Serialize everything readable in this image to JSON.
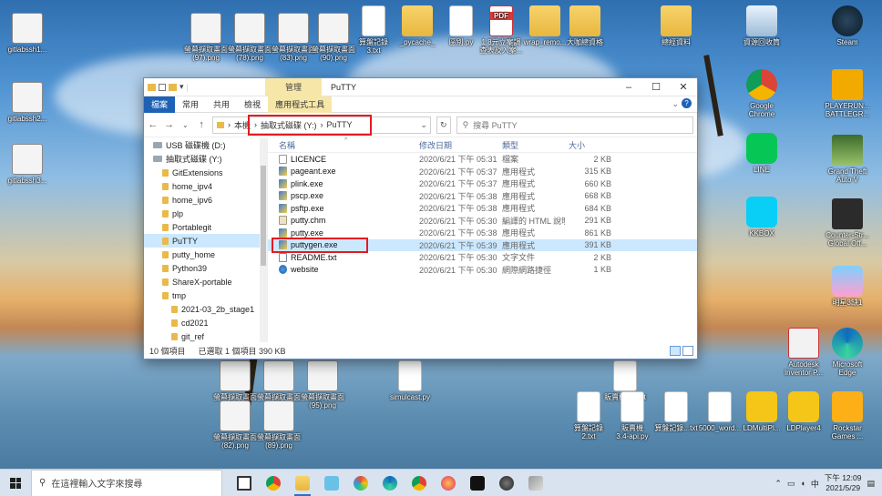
{
  "desktop": {
    "icons_left": [
      {
        "label": "gitlabssh1...",
        "icon": "thumbnail-icon"
      },
      {
        "label": "gitlabssh2...",
        "icon": "thumbnail-icon"
      },
      {
        "label": "gitlabssh3...",
        "icon": "thumbnail-icon"
      }
    ],
    "icons_top": [
      {
        "label": "螢幕擷取畫面\n(97).png",
        "icon": "thumbnail-icon"
      },
      {
        "label": "螢幕擷取畫面\n(78).png",
        "icon": "thumbnail-icon"
      },
      {
        "label": "螢幕擷取畫面\n(83).png",
        "icon": "thumbnail-icon"
      },
      {
        "label": "螢幕擷取畫面\n(90).png",
        "icon": "thumbnail-icon"
      },
      {
        "label": "算盤記錄\n3.txt",
        "icon": "document-icon"
      },
      {
        "label": "_pycache_",
        "icon": "folder-icon"
      },
      {
        "label": "區別.py",
        "icon": "document-icon"
      },
      {
        "label": "1.8元立案調\n查表及入案...",
        "icon": "pdf-icon"
      },
      {
        "label": "wrap_remo...",
        "icon": "folder-icon"
      },
      {
        "label": "大咖總資格",
        "icon": "folder-icon"
      },
      {
        "label": "總經資料",
        "icon": "folder-icon"
      },
      {
        "label": "資源回收筒",
        "icon": "recycle-bin-icon"
      },
      {
        "label": "Steam",
        "icon": "steam-icon"
      }
    ],
    "icons_right": [
      {
        "label": "Google\nChrome",
        "icon": "chrome-icon"
      },
      {
        "label": "LINE",
        "icon": "line-icon"
      },
      {
        "label": "KKBOX",
        "icon": "kkbox-icon"
      },
      {
        "label": "PLAYERUN...\nBATTLEGR...",
        "icon": "pubg-icon"
      },
      {
        "label": "Grand Theft\nAuto V",
        "icon": "gta-icon"
      },
      {
        "label": "Counter-Str...\nGlobal Off...",
        "icon": "csgo-icon"
      },
      {
        "label": "明星3缺1",
        "icon": "game-icon"
      },
      {
        "label": "Autodesk\nInventor P...",
        "icon": "autodesk-icon"
      },
      {
        "label": "Microsoft\nEdge",
        "icon": "edge-icon"
      }
    ],
    "icons_bottom": [
      {
        "label": "螢幕擷取畫面\n(84).png",
        "icon": "thumbnail-icon"
      },
      {
        "label": "螢幕擷取畫面\n(88).png",
        "icon": "thumbnail-icon"
      },
      {
        "label": "螢幕擷取畫面\n(95).png",
        "icon": "thumbnail-icon"
      },
      {
        "label": "simulcast.py",
        "icon": "document-icon"
      },
      {
        "label": "販賣機3.4.txt",
        "icon": "document-icon"
      },
      {
        "label": "螢幕擷取畫面\n(82).png",
        "icon": "thumbnail-icon"
      },
      {
        "label": "螢幕擷取畫面\n(89).png",
        "icon": "thumbnail-icon"
      },
      {
        "label": "算盤記錄\n2.txt",
        "icon": "document-icon"
      },
      {
        "label": "販賣機\n3.4-api.py",
        "icon": "document-icon"
      },
      {
        "label": "算盤記錄...txt",
        "icon": "document-icon"
      },
      {
        "label": "5000_word...",
        "icon": "document-icon"
      },
      {
        "label": "LDMultiPl...",
        "icon": "ldmulti-icon"
      },
      {
        "label": "LDPlayer4",
        "icon": "ldplayer-icon"
      },
      {
        "label": "Rockstar\nGames ...",
        "icon": "rockstar-icon"
      }
    ]
  },
  "explorer": {
    "title": "PuTTY",
    "management_tab": "管理",
    "ribbon_tabs": [
      "檔案",
      "常用",
      "共用",
      "檢視",
      "應用程式工具"
    ],
    "address": {
      "segment1": "本機",
      "segment2": "抽取式磁碟 (Y:)",
      "segment3": "PuTTY"
    },
    "search_placeholder": "搜尋 PuTTY",
    "nav_items": [
      {
        "label": "USB 磁碟機 (D:)",
        "kind": "drive",
        "indent": 1,
        "selected": false
      },
      {
        "label": "抽取式磁碟 (Y:)",
        "kind": "drive",
        "indent": 1,
        "selected": false
      },
      {
        "label": "GitExtensions",
        "kind": "folder",
        "indent": 2,
        "selected": false
      },
      {
        "label": "home_ipv4",
        "kind": "folder",
        "indent": 2,
        "selected": false
      },
      {
        "label": "home_ipv6",
        "kind": "folder",
        "indent": 2,
        "selected": false
      },
      {
        "label": "plp",
        "kind": "folder",
        "indent": 2,
        "selected": false
      },
      {
        "label": "Portablegit",
        "kind": "folder",
        "indent": 2,
        "selected": false
      },
      {
        "label": "PuTTY",
        "kind": "folder",
        "indent": 2,
        "selected": true
      },
      {
        "label": "putty_home",
        "kind": "folder",
        "indent": 2,
        "selected": false
      },
      {
        "label": "Python39",
        "kind": "folder",
        "indent": 2,
        "selected": false
      },
      {
        "label": "ShareX-portable",
        "kind": "folder",
        "indent": 2,
        "selected": false
      },
      {
        "label": "tmp",
        "kind": "folder",
        "indent": 2,
        "selected": false
      },
      {
        "label": "2021-03_2b_stage1",
        "kind": "folder",
        "indent": 3,
        "selected": false
      },
      {
        "label": "cd2021",
        "kind": "folder",
        "indent": 3,
        "selected": false
      },
      {
        "label": "git_ref",
        "kind": "folder",
        "indent": 3,
        "selected": false
      },
      {
        "label": "stage1_hw18",
        "kind": "folder",
        "indent": 3,
        "selected": false
      }
    ],
    "columns": [
      "名稱",
      "修改日期",
      "類型",
      "大小"
    ],
    "files": [
      {
        "name": "LICENCE",
        "date": "2020/6/21 下午 05:31",
        "type": "檔案",
        "size": "2 KB",
        "icon": "fi-doc",
        "selected": false
      },
      {
        "name": "pageant.exe",
        "date": "2020/6/21 下午 05:37",
        "type": "應用程式",
        "size": "315 KB",
        "icon": "fi-exe",
        "selected": false
      },
      {
        "name": "plink.exe",
        "date": "2020/6/21 下午 05:37",
        "type": "應用程式",
        "size": "660 KB",
        "icon": "fi-exe",
        "selected": false
      },
      {
        "name": "pscp.exe",
        "date": "2020/6/21 下午 05:38",
        "type": "應用程式",
        "size": "668 KB",
        "icon": "fi-exe",
        "selected": false
      },
      {
        "name": "psftp.exe",
        "date": "2020/6/21 下午 05:38",
        "type": "應用程式",
        "size": "684 KB",
        "icon": "fi-exe",
        "selected": false
      },
      {
        "name": "putty.chm",
        "date": "2020/6/21 下午 05:30",
        "type": "編譯的 HTML 說明...",
        "size": "291 KB",
        "icon": "fi-chm",
        "selected": false
      },
      {
        "name": "putty.exe",
        "date": "2020/6/21 下午 05:38",
        "type": "應用程式",
        "size": "861 KB",
        "icon": "fi-exe",
        "selected": false
      },
      {
        "name": "puttygen.exe",
        "date": "2020/6/21 下午 05:39",
        "type": "應用程式",
        "size": "391 KB",
        "icon": "fi-exe",
        "selected": true
      },
      {
        "name": "README.txt",
        "date": "2020/6/21 下午 05:30",
        "type": "文字文件",
        "size": "2 KB",
        "icon": "fi-txt",
        "selected": false
      },
      {
        "name": "website",
        "date": "2020/6/21 下午 05:30",
        "type": "網際網路捷徑",
        "size": "1 KB",
        "icon": "fi-web",
        "selected": false
      }
    ],
    "status": {
      "count": "10 個項目",
      "selected": "已選取 1 個項目 390 KB"
    }
  },
  "taskbar": {
    "search_placeholder": "在這裡輸入文字來搜尋",
    "apps": [
      "task-view-icon",
      "chrome-icon",
      "file-explorer-icon",
      "notepad-icon",
      "paint-icon",
      "edge-icon",
      "chrome-alt-icon",
      "firefox-icon",
      "terminal-icon",
      "fingerprint-icon",
      "tool-icon"
    ],
    "tray_lang": "中",
    "time": "下午 12:09",
    "date": "2021/5/29"
  },
  "colors": {
    "accent": "#1e62b5",
    "highlight": "#e31b23",
    "selection": "#cce8ff",
    "mgmt_tab": "#f6e7a8"
  }
}
